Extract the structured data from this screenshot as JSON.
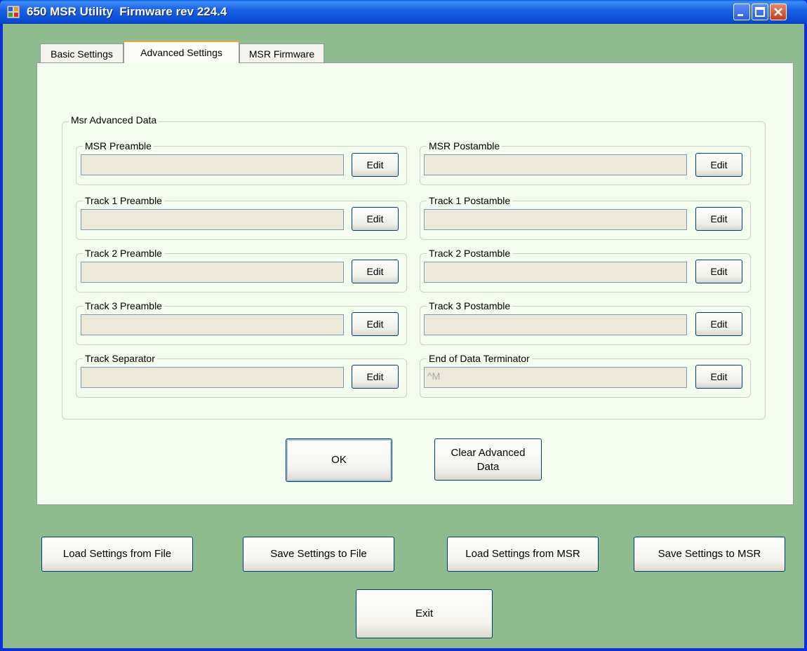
{
  "window": {
    "title": "650 MSR Utility  Firmware rev 224.4",
    "icon": "app-window-icon",
    "controls": [
      "minimize-icon",
      "maximize-icon",
      "close-icon"
    ]
  },
  "tabs": [
    {
      "label": "Basic Settings",
      "selected": false
    },
    {
      "label": "Advanced Settings",
      "selected": true
    },
    {
      "label": "MSR Firmware",
      "selected": false
    }
  ],
  "advanced": {
    "group_title": "Msr Advanced Data",
    "edit_label": "Edit",
    "fields": {
      "msr_preamble": {
        "label": "MSR Preamble",
        "value": ""
      },
      "msr_postamble": {
        "label": "MSR Postamble",
        "value": ""
      },
      "track1_preamble": {
        "label": "Track 1 Preamble",
        "value": ""
      },
      "track1_postamble": {
        "label": "Track 1 Postamble",
        "value": ""
      },
      "track2_preamble": {
        "label": "Track 2 Preamble",
        "value": ""
      },
      "track2_postamble": {
        "label": "Track 2 Postamble",
        "value": ""
      },
      "track3_preamble": {
        "label": "Track 3 Preamble",
        "value": ""
      },
      "track3_postamble": {
        "label": "Track 3 Postamble",
        "value": ""
      },
      "track_separator": {
        "label": "Track Separator",
        "value": ""
      },
      "end_terminator": {
        "label": "End of Data Terminator",
        "value": "^M"
      }
    },
    "ok_label": "OK",
    "clear_label_line1": "Clear Advanced",
    "clear_label_line2": "Data"
  },
  "bottom": {
    "load_file": "Load Settings from File",
    "save_file": "Save Settings to File",
    "load_msr": "Load Settings from MSR",
    "save_msr": "Save Settings to MSR",
    "exit": "Exit"
  },
  "colors": {
    "client_bg": "#8fbc8f",
    "tab_page_bg": "#f5fcf0",
    "titlebar": "#0a5ee6",
    "selected_tab_accent": "#f2a33a"
  }
}
